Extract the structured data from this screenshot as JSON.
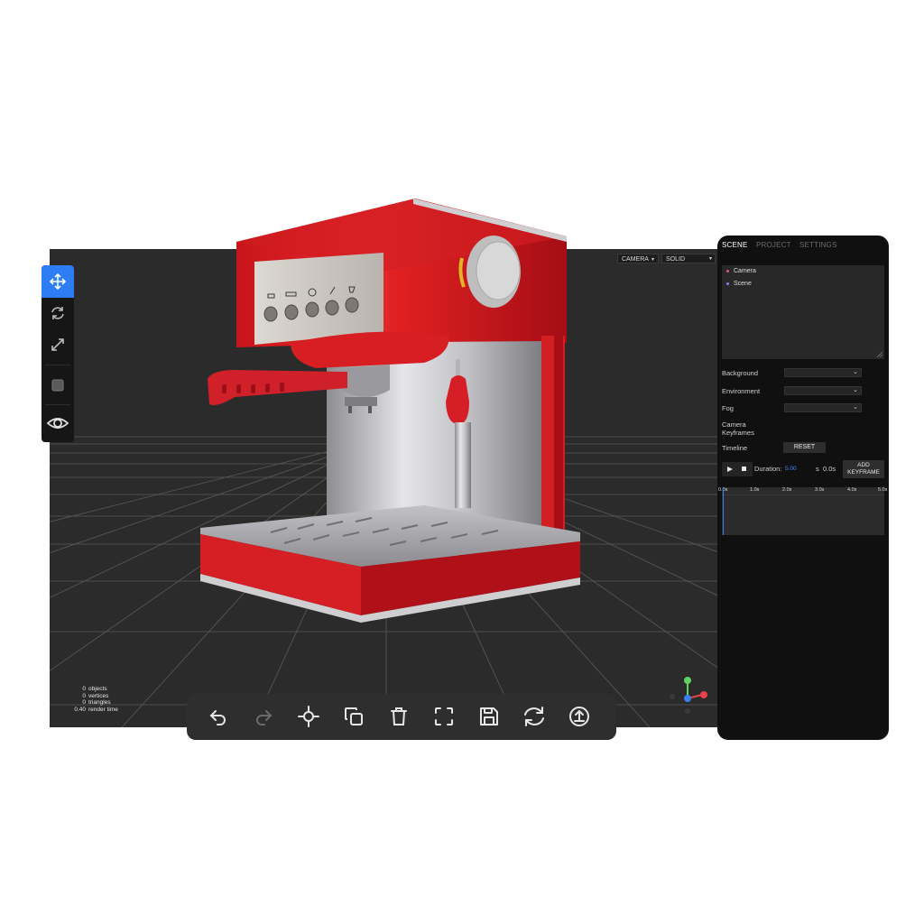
{
  "viewport": {
    "camera_select": "CAMERA",
    "shading_select": "SOLID",
    "stats": [
      {
        "value": "0",
        "label": "objects"
      },
      {
        "value": "0",
        "label": "vertices"
      },
      {
        "value": "0",
        "label": "triangles"
      },
      {
        "value": "0.40",
        "label": "render time"
      }
    ]
  },
  "left_toolbar": {
    "tools": [
      "move-icon",
      "rotate-icon",
      "scale-icon",
      "square-icon",
      "eye-icon"
    ],
    "active_tool": "move-icon",
    "accent_color": "#2f7df6"
  },
  "bottom_toolbar": {
    "buttons": [
      "undo-icon",
      "redo-icon",
      "crosshair-icon",
      "copy-icon",
      "trash-icon",
      "focus-frame-icon",
      "save-icon",
      "refresh-icon",
      "upload-icon"
    ]
  },
  "panel": {
    "tabs": [
      "SCENE",
      "PROJECT",
      "SETTINGS"
    ],
    "active_tab": "SCENE",
    "tree": [
      {
        "label": "Camera",
        "color": "#e05a6e"
      },
      {
        "label": "Scene",
        "color": "#8a7cf0"
      }
    ],
    "properties": {
      "background": "Background",
      "environment": "Environment",
      "fog": "Fog",
      "camera_keyframes_1": "Camera",
      "camera_keyframes_2": "Keyframes",
      "timeline": "Timeline",
      "reset": "RESET"
    },
    "playback": {
      "duration_label": "Duration:",
      "duration_value": "5.00",
      "duration_unit": "s",
      "current_time": "0.0s",
      "add_keyframe_1": "ADD",
      "add_keyframe_2": "KEYFRAME"
    },
    "timeline_ticks": [
      "0.0s",
      "1.0s",
      "2.0s",
      "3.0s",
      "4.0s",
      "5.0s"
    ]
  },
  "gizmo": {
    "x_color": "#e8434b",
    "y_color": "#5fd35f",
    "z_color": "#3b7ff0"
  }
}
